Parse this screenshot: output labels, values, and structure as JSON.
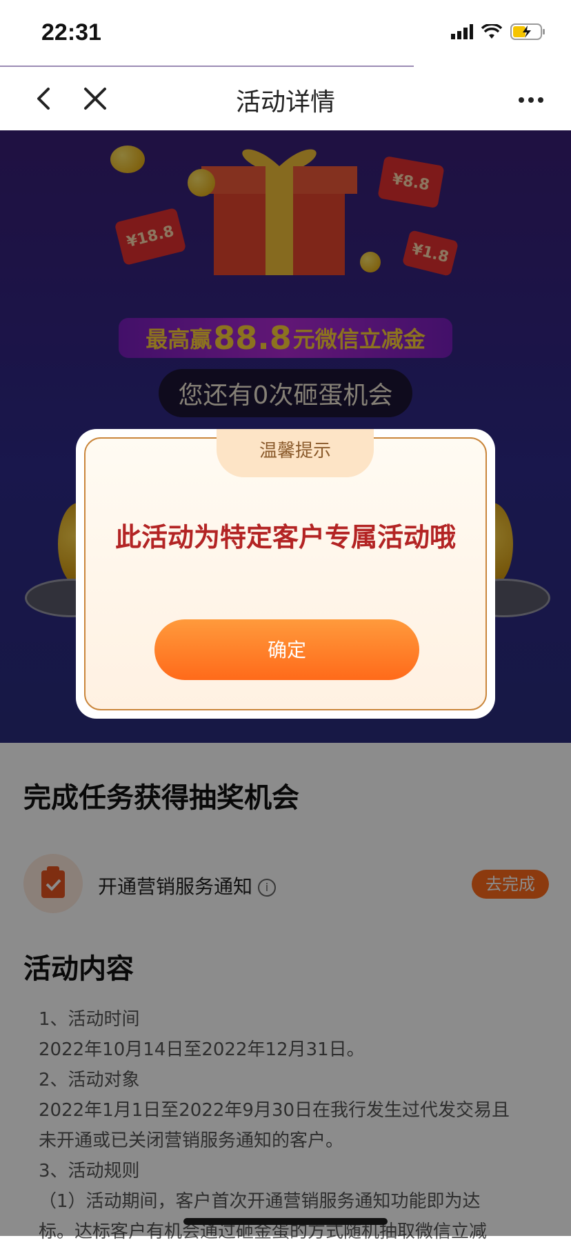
{
  "status_bar": {
    "time": "22:31"
  },
  "nav": {
    "title": "活动详情"
  },
  "hero": {
    "banner_prefix": "最高赢",
    "banner_amount": "88.8",
    "banner_suffix": "元微信立减金",
    "chance_text": "您还有0次砸蛋机会",
    "coupons": [
      "¥18.8",
      "¥8.8",
      "¥1.8"
    ]
  },
  "tasks": {
    "title": "完成任务获得抽奖机会",
    "items": [
      {
        "label": "开通营销服务通知",
        "info": "i",
        "button": "去完成"
      }
    ]
  },
  "activity": {
    "title": "活动内容",
    "lines": [
      "1、活动时间",
      "2022年10月14日至2022年12月31日。",
      "2、活动对象",
      "2022年1月1日至2022年9月30日在我行发生过代发交易且",
      "未开通或已关闭营销服务通知的客户。",
      "3、活动规则",
      "（1）活动期间，客户首次开通营销服务通知功能即为达",
      "标。达标客户有机会通过砸金蛋的方式随机抽取微信立减"
    ]
  },
  "dialog": {
    "tab": "温馨提示",
    "message": "此活动为特定客户专属活动哦",
    "confirm": "确定"
  },
  "colors": {
    "accent": "#ff6a1a",
    "hero_bg": "#3a1f78",
    "dialog_text": "#b32424"
  }
}
